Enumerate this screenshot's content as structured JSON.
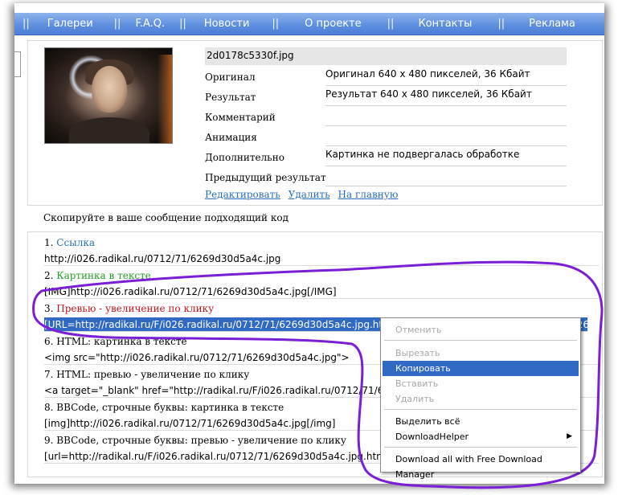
{
  "nav": {
    "items": [
      "Галереи",
      "F.A.Q.",
      "Новости",
      "О проекте",
      "Контакты",
      "Реклама"
    ]
  },
  "info": {
    "filename": "2d0178c5330f.jpg",
    "rows": [
      {
        "label": "Оригинал",
        "value": "Оригинал 640 x 480 пикселей, 36 Кбайт"
      },
      {
        "label": "Результат",
        "value": "Результат 640 x 480 пикселей, 36 Кбайт"
      },
      {
        "label": "Комментарий",
        "value": ""
      },
      {
        "label": "Анимация",
        "value": ""
      },
      {
        "label": "Дополнительно",
        "value": "Картинка не подвергалась обработке"
      },
      {
        "label": "Предыдущий результат",
        "value": ""
      }
    ],
    "links": [
      "Редактировать",
      "Удалить",
      "На главную"
    ]
  },
  "copy_heading": "Скопируйте в ваше сообщение подходящий код",
  "codes": [
    {
      "num": "1.",
      "title": "Ссылка",
      "code": "http://i026.radikal.ru/0712/71/6269d30d5a4c.jpg"
    },
    {
      "num": "2.",
      "title": "Картинка в тексте",
      "code": "[IMG]http://i026.radikal.ru/0712/71/6269d30d5a4c.jpg[/IMG]"
    },
    {
      "num": "3.",
      "title": "Превью - увеличение по клику",
      "code": "[URL=http://radikal.ru/F/i026.radikal.ru/0712/71/6269d30d5a4c.jpg.html][IMG]http://i026.radikal.ru/0712/71/6269d30"
    },
    {
      "num": "6.",
      "title": "HTML: картинка в тексте",
      "code": "<img src=\"http://i026.radikal.ru/0712/71/6269d30d5a4c.jpg\">"
    },
    {
      "num": "7.",
      "title": "HTML: превью - увеличение по клику",
      "code": "<a target=\"_blank\" href=\"http://radikal.ru/F/i026.radikal.ru/0712/71/6269d"
    },
    {
      "num": "8.",
      "title": "BBCode, строчные буквы: картинка в тексте",
      "code": "[img]http://i026.radikal.ru/0712/71/6269d30d5a4c.jpg[/img]"
    },
    {
      "num": "9.",
      "title": "BBCode, строчные буквы: превью - увеличение по клику",
      "code": "[url=http://radikal.ru/F/i026.radikal.ru/0712/71/6269d30d5a4c.jpg.html][img]"
    }
  ],
  "context_menu": {
    "undo": "Отменить",
    "cut": "Вырезать",
    "copy": "Копировать",
    "paste": "Вставить",
    "delete": "Удалить",
    "select_all": "Выделить всё",
    "download_helper": "DownloadHelper",
    "fdm": "Download all with Free Download Manager"
  },
  "colors": {
    "nav": "#5f8fe0",
    "link": "#2a6fb8",
    "selection": "#316ac5",
    "scribble": "#7b1fd6"
  }
}
